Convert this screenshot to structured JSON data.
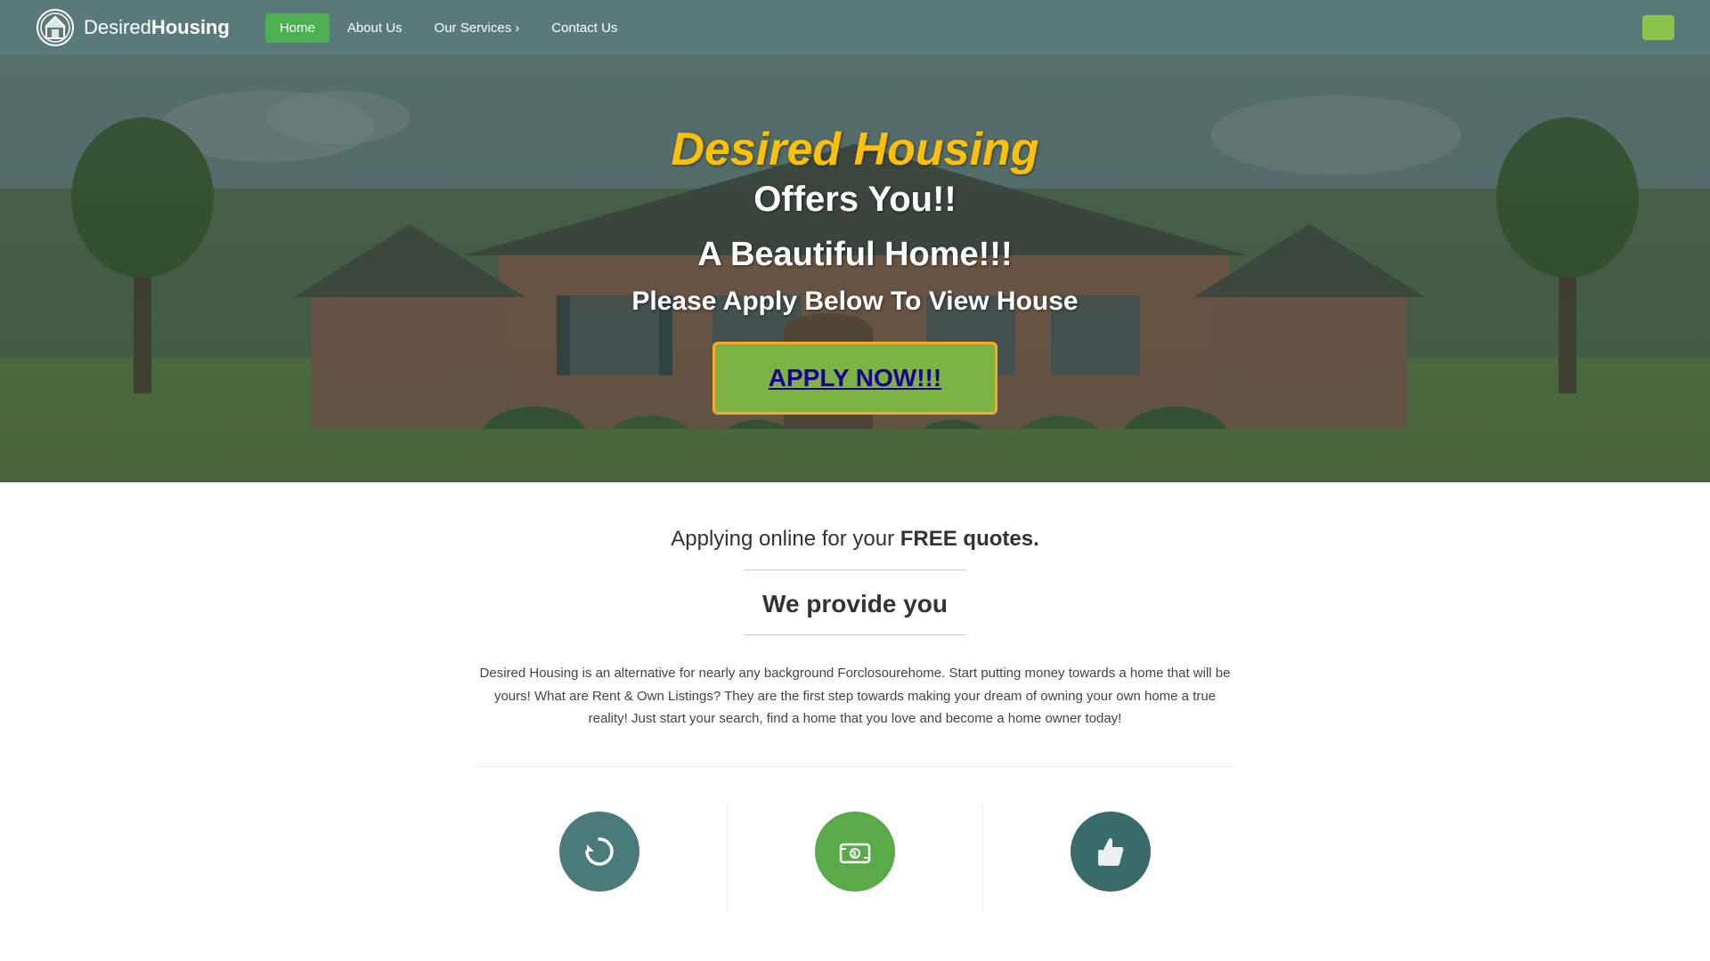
{
  "navbar": {
    "logo_text_normal": "Desired",
    "logo_text_bold": "Housing",
    "nav_items": [
      {
        "label": "Home",
        "active": true
      },
      {
        "label": "About Us",
        "active": false
      },
      {
        "label": "Our Services",
        "active": false,
        "has_dropdown": true
      },
      {
        "label": "Contact Us",
        "active": false
      }
    ],
    "cta_button_label": ""
  },
  "hero": {
    "title_colored": "Desired Housing",
    "subtitle": "Offers You!!",
    "line2": "A Beautiful Home!!!",
    "line3": "Please Apply Below To View House",
    "apply_button_label": "APPLY NOW!!!"
  },
  "content": {
    "free_quotes_line_normal": "Applying online for your ",
    "free_quotes_line_bold": "FREE quotes.",
    "section_title": "We provide you",
    "description": "Desired Housing is an alternative for nearly any background Forclosourehome. Start putting money towards a home that will be yours! What are Rent & Own Listings? They are the first step towards making your dream of owning your own home a true reality! Just start your search, find a home that you love and become a home owner today!"
  },
  "icons": [
    {
      "symbol": "↺",
      "color": "teal"
    },
    {
      "symbol": "💵",
      "color": "green"
    },
    {
      "symbol": "👍",
      "color": "dark-teal"
    }
  ],
  "colors": {
    "navbar_bg": "#5a7a7a",
    "active_nav": "#4CAF50",
    "hero_title": "#FFC107",
    "apply_bg": "#7CB342",
    "apply_border": "#F9A825",
    "apply_text": "#1a0099"
  }
}
